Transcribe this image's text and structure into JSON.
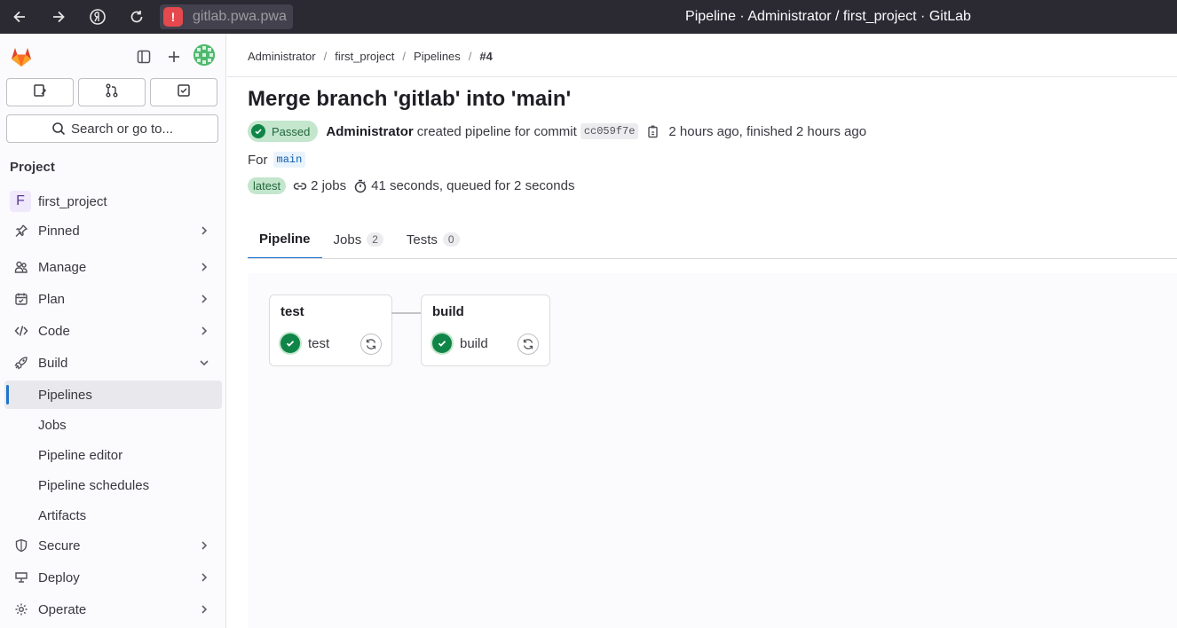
{
  "browser": {
    "url": "gitlab.pwa.pwa",
    "window_title": "Pipeline · Administrator / first_project · GitLab"
  },
  "sidebar": {
    "search_label": "Search or go to...",
    "section_title": "Project",
    "project": {
      "initial": "F",
      "name": "first_project"
    },
    "items": [
      {
        "label": "Pinned",
        "icon": "thumbtack-icon"
      },
      {
        "label": "Manage",
        "icon": "users-icon"
      },
      {
        "label": "Plan",
        "icon": "calendar-icon"
      },
      {
        "label": "Code",
        "icon": "code-icon"
      },
      {
        "label": "Build",
        "icon": "rocket-icon"
      }
    ],
    "build_sub": [
      {
        "label": "Pipelines",
        "active": true
      },
      {
        "label": "Jobs"
      },
      {
        "label": "Pipeline editor"
      },
      {
        "label": "Pipeline schedules"
      },
      {
        "label": "Artifacts"
      }
    ],
    "items_after": [
      {
        "label": "Secure",
        "icon": "shield-icon"
      },
      {
        "label": "Deploy",
        "icon": "deploy-icon"
      },
      {
        "label": "Operate",
        "icon": "cloud-gear-icon"
      }
    ]
  },
  "breadcrumb": [
    "Administrator",
    "first_project",
    "Pipelines",
    "#4"
  ],
  "pipeline": {
    "title": "Merge branch 'gitlab' into 'main'",
    "status": "Passed",
    "author": "Administrator",
    "action_text": "created pipeline for commit",
    "sha": "cc059f7e",
    "time_text": "2 hours ago, finished 2 hours ago",
    "for_label": "For",
    "ref": "main",
    "latest_badge": "latest",
    "jobs_text": "2 jobs",
    "duration_text": "41 seconds, queued for 2 seconds"
  },
  "tabs": [
    {
      "label": "Pipeline",
      "active": true
    },
    {
      "label": "Jobs",
      "count": "2"
    },
    {
      "label": "Tests",
      "count": "0"
    }
  ],
  "stages": [
    {
      "name": "test",
      "job": "test",
      "status": "success"
    },
    {
      "name": "build",
      "job": "build",
      "status": "success"
    }
  ],
  "colors": {
    "success": "#108548",
    "active_indicator": "#1f75cb",
    "browser_bar": "#2b2a33"
  }
}
